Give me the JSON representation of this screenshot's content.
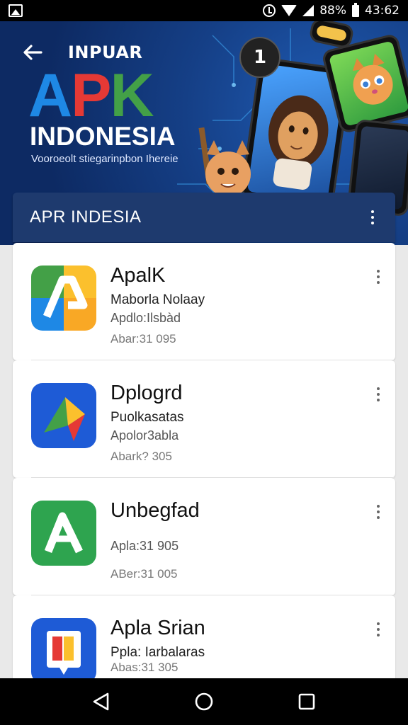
{
  "status_bar": {
    "battery_text": "88%",
    "time": "43:62",
    "icons": [
      "gallery-icon",
      "alarm-icon",
      "wifi-icon",
      "signal-icon",
      "battery-icon"
    ]
  },
  "hero": {
    "top_label": "INPUAR",
    "brand": {
      "a": "A",
      "p": "P",
      "k": "K"
    },
    "title": "INDONESIA",
    "tagline": "Vooroeolt stiegarinpbon Ihereie",
    "badge_glyph": "1",
    "colors": {
      "a": "#1e88e5",
      "p": "#e53935",
      "k": "#43a047"
    }
  },
  "card": {
    "title": "APR  INDESIA"
  },
  "apps": [
    {
      "name": "ApalK",
      "line1": "Maborla Nolaay",
      "line2": "Apdlo:Ilsbàd",
      "line3": "Abar:31 095",
      "icon": "app-icon-a-multicolor"
    },
    {
      "name": "Dplogrd",
      "line1": "Puolkasatas",
      "line2": "Apolor3abla",
      "line3": "Abark? 305",
      "icon": "app-icon-play-triangle"
    },
    {
      "name": "Unbegfad",
      "line1": "Apla:31 905",
      "line2": "",
      "line3": "ABer:31 005",
      "icon": "app-icon-green-a"
    },
    {
      "name": "Apla Srian",
      "line1": "Ppla: Iarbalaras",
      "line2": "",
      "line3": "Abas:31 305",
      "icon": "app-icon-book"
    }
  ],
  "nav": [
    "back-icon",
    "home-icon",
    "recents-icon"
  ],
  "colors": {
    "header": "#1e3a6e",
    "hero_bg": "#153f86"
  }
}
